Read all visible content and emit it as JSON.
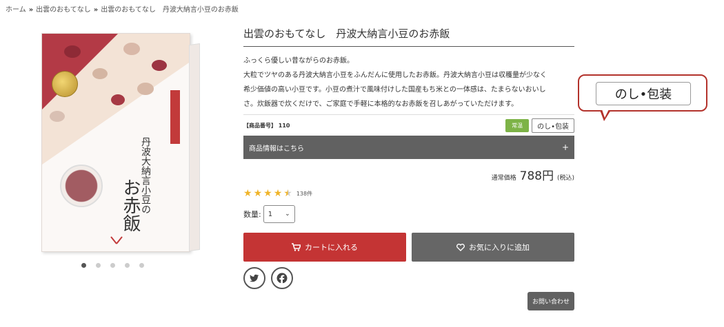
{
  "breadcrumb": {
    "items": [
      "ホーム",
      "出雲のおもてなし",
      "出雲のおもてなし　丹波大納言小豆のお赤飯"
    ],
    "separator": "»"
  },
  "product": {
    "title": "出雲のおもてなし　丹波大納言小豆のお赤飯",
    "description_lines": [
      "ふっくら優しい昔ながらのお赤飯。",
      "大粒でツヤのある丹波大納言小豆をふんだんに使用したお赤飯。丹波大納言小豆は収穫量が少なく",
      "希少価値の高い小豆です。小豆の煮汁で風味付けした国産もち米との一体感は、たまらないおいし",
      "さ。炊飯器で炊くだけで、ご家庭で手軽に本格的なお赤飯を召しあがっていただけます。"
    ],
    "sku_label": "【商品番号】",
    "sku_value": "110",
    "badge_temp": "常温",
    "badge_wrap": "のし•包装",
    "accordion_label": "商品情報はこちら",
    "accordion_icon": "+",
    "price_prefix": "通常価格",
    "price_amount": "788円",
    "price_suffix": "(税込)",
    "rating": 4.5,
    "review_count": "138件",
    "qty_label": "数量:",
    "qty_value": "1",
    "cart_button": "カートに入れる",
    "fav_button": "お気に入りに追加",
    "inquiry_button": "お問い合わせ",
    "gallery_count": 5,
    "gallery_active": 1
  },
  "callout": {
    "text": "のし•包装"
  },
  "colors": {
    "cart": "#c43434",
    "dark_button": "#616161",
    "badge_green": "#7db347",
    "callout_border": "#b3322b",
    "star": "#f0b429"
  },
  "icons": {
    "cart": "cart-icon",
    "heart": "heart-icon",
    "twitter": "twitter-icon",
    "facebook": "facebook-icon"
  }
}
